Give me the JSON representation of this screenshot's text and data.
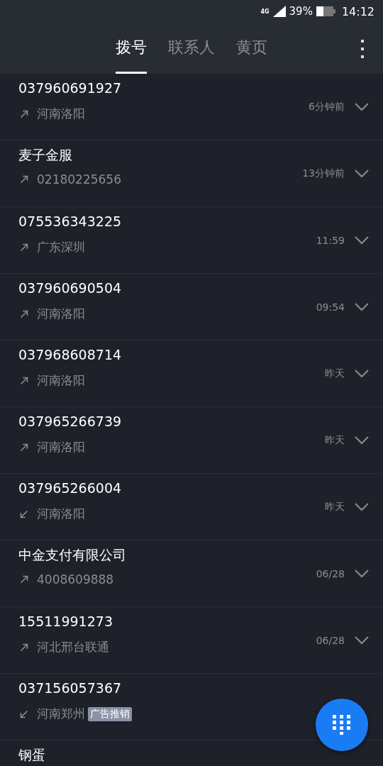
{
  "status_bar": {
    "network": "4G",
    "battery": "39%",
    "time": "14:12"
  },
  "tabs": [
    {
      "label": "拨号",
      "selected": true
    },
    {
      "label": "联系人",
      "selected": false
    },
    {
      "label": "黄页",
      "selected": false
    }
  ],
  "calls": [
    {
      "title": "037960691927",
      "kind": "outgoing",
      "detail": "河南洛阳",
      "time": "6分钟前"
    },
    {
      "title": "麦子金服",
      "kind": "outgoing",
      "detail": "02180225656",
      "time": "13分钟前"
    },
    {
      "title": "075536343225",
      "kind": "outgoing",
      "detail": "广东深圳",
      "time": "11:59"
    },
    {
      "title": "037960690504",
      "kind": "outgoing",
      "detail": "河南洛阳",
      "time": "09:54"
    },
    {
      "title": "037968608714",
      "kind": "outgoing",
      "detail": "河南洛阳",
      "time": "昨天"
    },
    {
      "title": "037965266739",
      "kind": "outgoing",
      "detail": "河南洛阳",
      "time": "昨天"
    },
    {
      "title": "037965266004",
      "kind": "incoming",
      "detail": "河南洛阳",
      "time": "昨天"
    },
    {
      "title": "中金支付有限公司",
      "kind": "outgoing",
      "detail": "4008609888",
      "time": "06/28"
    },
    {
      "title": "15511991273",
      "kind": "outgoing",
      "detail": "河北邢台联通",
      "time": "06/28"
    },
    {
      "title": "037156057367",
      "kind": "incoming",
      "detail": "河南郑州",
      "tag": "广告推销"
    },
    {
      "title": "钢蛋"
    }
  ]
}
